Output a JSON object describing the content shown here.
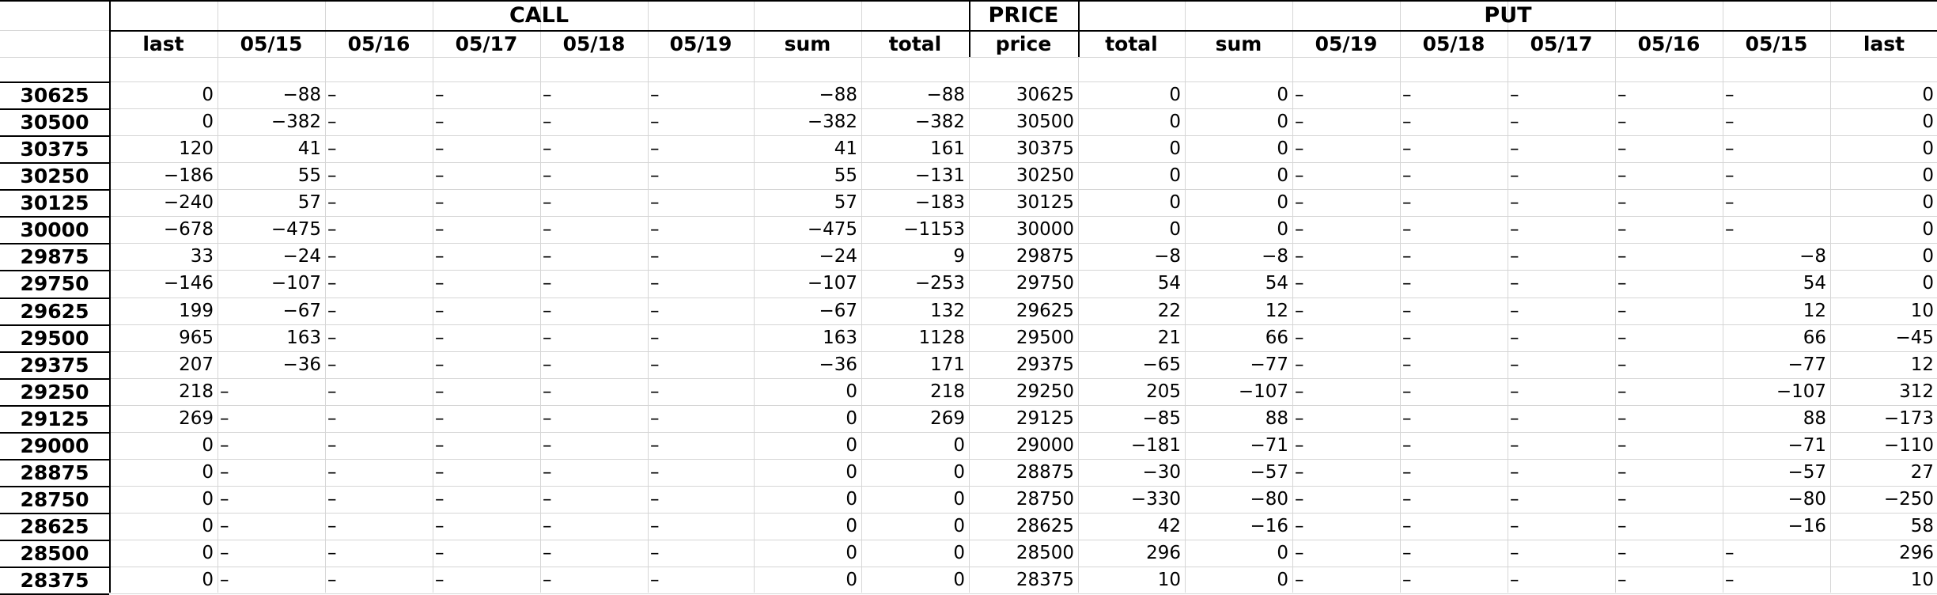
{
  "headers": {
    "call": "CALL",
    "price": "PRICE",
    "put": "PUT"
  },
  "subheaders": {
    "call": [
      "last",
      "05/15",
      "05/16",
      "05/17",
      "05/18",
      "05/19",
      "sum",
      "total"
    ],
    "price": "price",
    "put": [
      "total",
      "sum",
      "05/19",
      "05/18",
      "05/17",
      "05/16",
      "05/15",
      "last"
    ]
  },
  "dash": "–",
  "rows": [
    {
      "strike": "30625",
      "call": [
        "0",
        "-88",
        "–",
        "–",
        "–",
        "–",
        "-88",
        "-88"
      ],
      "price": "30625",
      "put": [
        "0",
        "0",
        "–",
        "–",
        "–",
        "–",
        "–",
        "0"
      ]
    },
    {
      "strike": "30500",
      "call": [
        "0",
        "-382",
        "–",
        "–",
        "–",
        "–",
        "-382",
        "-382"
      ],
      "price": "30500",
      "put": [
        "0",
        "0",
        "–",
        "–",
        "–",
        "–",
        "–",
        "0"
      ]
    },
    {
      "strike": "30375",
      "call": [
        "120",
        "41",
        "–",
        "–",
        "–",
        "–",
        "41",
        "161"
      ],
      "price": "30375",
      "put": [
        "0",
        "0",
        "–",
        "–",
        "–",
        "–",
        "–",
        "0"
      ]
    },
    {
      "strike": "30250",
      "call": [
        "-186",
        "55",
        "–",
        "–",
        "–",
        "–",
        "55",
        "-131"
      ],
      "price": "30250",
      "put": [
        "0",
        "0",
        "–",
        "–",
        "–",
        "–",
        "–",
        "0"
      ]
    },
    {
      "strike": "30125",
      "call": [
        "-240",
        "57",
        "–",
        "–",
        "–",
        "–",
        "57",
        "-183"
      ],
      "price": "30125",
      "put": [
        "0",
        "0",
        "–",
        "–",
        "–",
        "–",
        "–",
        "0"
      ]
    },
    {
      "strike": "30000",
      "call": [
        "-678",
        "-475",
        "–",
        "–",
        "–",
        "–",
        "-475",
        "-1153"
      ],
      "price": "30000",
      "put": [
        "0",
        "0",
        "–",
        "–",
        "–",
        "–",
        "–",
        "0"
      ]
    },
    {
      "strike": "29875",
      "call": [
        "33",
        "-24",
        "–",
        "–",
        "–",
        "–",
        "-24",
        "9"
      ],
      "price": "29875",
      "put": [
        "-8",
        "-8",
        "–",
        "–",
        "–",
        "–",
        "-8",
        "0"
      ]
    },
    {
      "strike": "29750",
      "call": [
        "-146",
        "-107",
        "–",
        "–",
        "–",
        "–",
        "-107",
        "-253"
      ],
      "price": "29750",
      "put": [
        "54",
        "54",
        "–",
        "–",
        "–",
        "–",
        "54",
        "0"
      ]
    },
    {
      "strike": "29625",
      "call": [
        "199",
        "-67",
        "–",
        "–",
        "–",
        "–",
        "-67",
        "132"
      ],
      "price": "29625",
      "put": [
        "22",
        "12",
        "–",
        "–",
        "–",
        "–",
        "12",
        "10"
      ]
    },
    {
      "strike": "29500",
      "call": [
        "965",
        "163",
        "–",
        "–",
        "–",
        "–",
        "163",
        "1128"
      ],
      "price": "29500",
      "put": [
        "21",
        "66",
        "–",
        "–",
        "–",
        "–",
        "66",
        "-45"
      ]
    },
    {
      "strike": "29375",
      "call": [
        "207",
        "-36",
        "–",
        "–",
        "–",
        "–",
        "-36",
        "171"
      ],
      "price": "29375",
      "put": [
        "-65",
        "-77",
        "–",
        "–",
        "–",
        "–",
        "-77",
        "12"
      ]
    },
    {
      "strike": "29250",
      "call": [
        "218",
        "–",
        "–",
        "–",
        "–",
        "–",
        "0",
        "218"
      ],
      "price": "29250",
      "put": [
        "205",
        "-107",
        "–",
        "–",
        "–",
        "–",
        "-107",
        "312"
      ]
    },
    {
      "strike": "29125",
      "call": [
        "269",
        "–",
        "–",
        "–",
        "–",
        "–",
        "0",
        "269"
      ],
      "price": "29125",
      "put": [
        "-85",
        "88",
        "–",
        "–",
        "–",
        "–",
        "88",
        "-173"
      ]
    },
    {
      "strike": "29000",
      "call": [
        "0",
        "–",
        "–",
        "–",
        "–",
        "–",
        "0",
        "0"
      ],
      "price": "29000",
      "put": [
        "-181",
        "-71",
        "–",
        "–",
        "–",
        "–",
        "-71",
        "-110"
      ]
    },
    {
      "strike": "28875",
      "call": [
        "0",
        "–",
        "–",
        "–",
        "–",
        "–",
        "0",
        "0"
      ],
      "price": "28875",
      "put": [
        "-30",
        "-57",
        "–",
        "–",
        "–",
        "–",
        "-57",
        "27"
      ]
    },
    {
      "strike": "28750",
      "call": [
        "0",
        "–",
        "–",
        "–",
        "–",
        "–",
        "0",
        "0"
      ],
      "price": "28750",
      "put": [
        "-330",
        "-80",
        "–",
        "–",
        "–",
        "–",
        "-80",
        "-250"
      ]
    },
    {
      "strike": "28625",
      "call": [
        "0",
        "–",
        "–",
        "–",
        "–",
        "–",
        "0",
        "0"
      ],
      "price": "28625",
      "put": [
        "42",
        "-16",
        "–",
        "–",
        "–",
        "–",
        "-16",
        "58"
      ]
    },
    {
      "strike": "28500",
      "call": [
        "0",
        "–",
        "–",
        "–",
        "–",
        "–",
        "0",
        "0"
      ],
      "price": "28500",
      "put": [
        "296",
        "0",
        "–",
        "–",
        "–",
        "–",
        "–",
        "296"
      ]
    },
    {
      "strike": "28375",
      "call": [
        "0",
        "–",
        "–",
        "–",
        "–",
        "–",
        "0",
        "0"
      ],
      "price": "28375",
      "put": [
        "10",
        "0",
        "–",
        "–",
        "–",
        "–",
        "–",
        "10"
      ]
    }
  ]
}
